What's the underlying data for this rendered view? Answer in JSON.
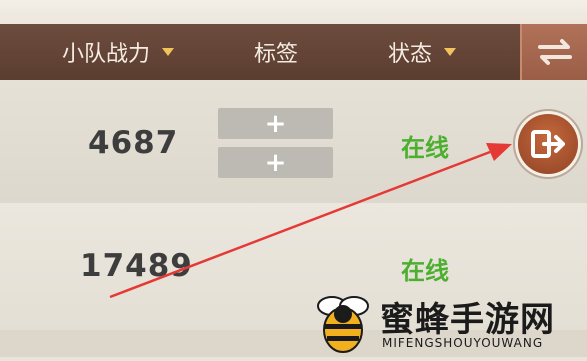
{
  "header": {
    "col_power": "小队战力",
    "col_tags": "标签",
    "col_status": "状态"
  },
  "rows": [
    {
      "power": "4687",
      "tag_buttons": [
        "+",
        "+"
      ],
      "status": "在线"
    },
    {
      "power": "17489",
      "status": "在线"
    }
  ],
  "icons": {
    "sort": "sort-arrow-icon",
    "swap": "swap-arrows-icon",
    "exit": "exit-door-icon",
    "annotation": "red-arrow-annotation",
    "watermark_logo": "bee-logo"
  },
  "colors": {
    "header_bg": "#5f4133",
    "accent_triangle": "#f2c35b",
    "online_green": "#4caf2f",
    "exit_button": "#b3582f",
    "annotation_red": "#e53935"
  },
  "watermark": {
    "title": "蜜蜂手游网",
    "subtitle": "MIFENGSHOUYOUWANG"
  }
}
